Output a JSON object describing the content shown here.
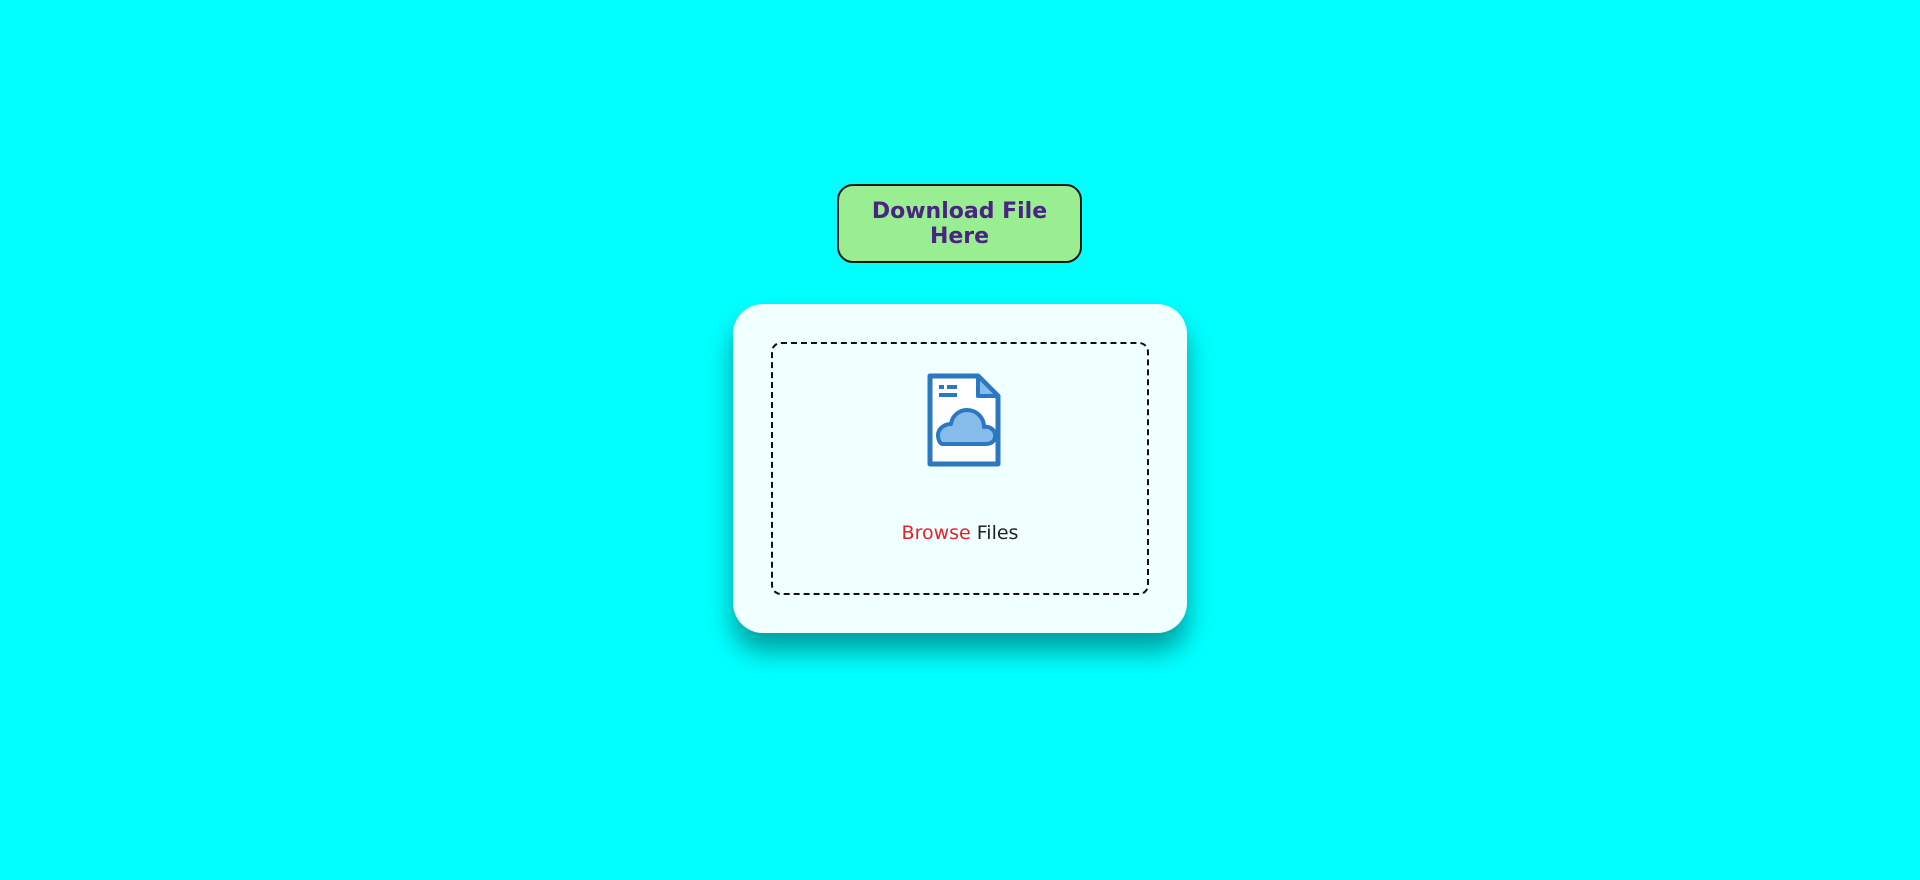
{
  "colors": {
    "background": "#00ffff",
    "button_bg": "#98ee90",
    "button_text": "#4b2483",
    "card_bg": "#f0ffff",
    "accent_red": "#e8202a",
    "icon_blue": "#2a78c2",
    "icon_fill": "#86bce9"
  },
  "download": {
    "label": "Download File Here"
  },
  "upload": {
    "icon": "cloud-file-icon",
    "browse_link": "Browse",
    "browse_suffix": "Files"
  }
}
